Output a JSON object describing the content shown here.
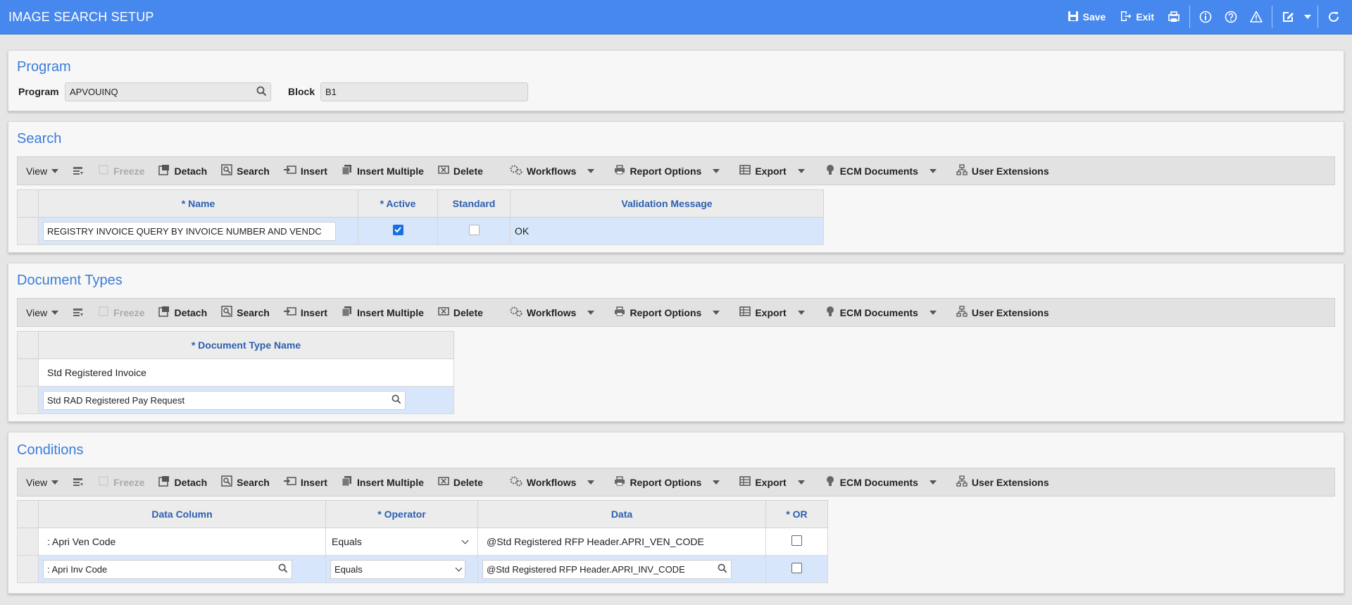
{
  "app": {
    "title": "IMAGE SEARCH SETUP",
    "actions": {
      "save": "Save",
      "exit": "Exit"
    },
    "icons": [
      "save-icon",
      "exit-icon",
      "print-icon",
      "info-icon",
      "help-icon",
      "warning-icon",
      "edit-icon",
      "refresh-icon"
    ]
  },
  "program_section": {
    "title": "Program",
    "program_label": "Program",
    "program_value": "APVOUINQ",
    "block_label": "Block",
    "block_value": "B1"
  },
  "toolbar": {
    "view": "View",
    "freeze": "Freeze",
    "detach": "Detach",
    "search": "Search",
    "insert": "Insert",
    "insert_multiple": "Insert Multiple",
    "delete": "Delete",
    "workflows": "Workflows",
    "report_options": "Report Options",
    "export": "Export",
    "ecm_documents": "ECM Documents",
    "user_extensions": "User Extensions"
  },
  "search_section": {
    "title": "Search",
    "columns": [
      "* Name",
      "* Active",
      "Standard",
      "Validation Message"
    ],
    "rows": [
      {
        "name": "REGISTRY INVOICE QUERY BY INVOICE NUMBER AND VENDC",
        "active": true,
        "standard": false,
        "validation": "OK"
      }
    ]
  },
  "doc_types_section": {
    "title": "Document Types",
    "columns": [
      "* Document Type Name"
    ],
    "rows": [
      {
        "name": "Std Registered Invoice"
      },
      {
        "name": "Std RAD Registered Pay Request"
      }
    ]
  },
  "conditions_section": {
    "title": "Conditions",
    "columns": [
      "Data Column",
      "* Operator",
      "Data",
      "* OR"
    ],
    "rows": [
      {
        "data_column": ": Apri Ven Code",
        "operator": "Equals",
        "data": "@Std Registered RFP Header.APRI_VEN_CODE",
        "or": false
      },
      {
        "data_column": ": Apri Inv Code",
        "operator": "Equals",
        "data": "@Std Registered RFP Header.APRI_INV_CODE",
        "or": false
      }
    ]
  },
  "colors": {
    "titlebar": "#4788ee",
    "section_title": "#3b7dd8",
    "header_text": "#2c5fb0",
    "selected_row": "#d7e6fb"
  }
}
